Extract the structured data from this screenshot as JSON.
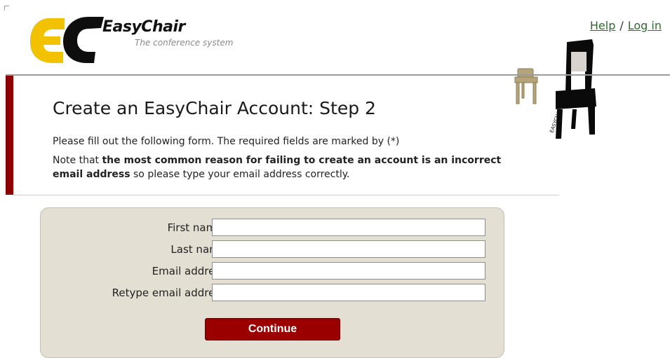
{
  "header": {
    "logo_title": "EasyChair",
    "logo_subtitle": "The conference system",
    "logo_letters": "EC",
    "logo_icon": "easychair-logo-icon",
    "chair_icon": "chair-illustration-icon",
    "chair_caption": "EASYCHAIR",
    "help_link": "Help",
    "separator": "/",
    "login_link": "Log in"
  },
  "intro": {
    "title": "Create an EasyChair Account: Step 2",
    "line1": "Please fill out the following form. The required fields are marked by (*)",
    "note_prefix": "Note that ",
    "note_bold": "the most common reason for failing to create an account is an incorrect email address",
    "note_suffix": " so please type your email address correctly."
  },
  "form": {
    "fields": [
      {
        "label": "First name",
        "marker": "†",
        "suffix": " (*):",
        "value": ""
      },
      {
        "label": "Last name (*):",
        "value": ""
      },
      {
        "label": "Email address (*):",
        "value": ""
      },
      {
        "label": "Retype email address (*):",
        "value": ""
      }
    ],
    "submit_label": "Continue"
  },
  "colors": {
    "accent_red": "#8b0000",
    "button_red": "#9b0000",
    "form_bg": "#e4dfd3",
    "link_green": "#2e6b2e",
    "logo_yellow": "#f2c200"
  }
}
